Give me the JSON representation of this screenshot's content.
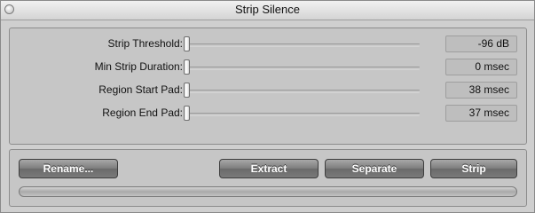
{
  "window": {
    "title": "Strip Silence"
  },
  "parameters": [
    {
      "label": "Strip Threshold:",
      "value": "-96 dB",
      "slider_position": 0.0
    },
    {
      "label": "Min Strip Duration:",
      "value": "0 msec",
      "slider_position": 0.0
    },
    {
      "label": "Region Start Pad:",
      "value": "38 msec",
      "slider_position": 0.0
    },
    {
      "label": "Region End Pad:",
      "value": "37 msec",
      "slider_position": 0.0
    }
  ],
  "actions": {
    "rename_label": "Rename...",
    "extract_label": "Extract",
    "separate_label": "Separate",
    "strip_label": "Strip"
  },
  "progress": {
    "fraction": 0.0
  },
  "icons": {
    "close": "close-icon"
  }
}
